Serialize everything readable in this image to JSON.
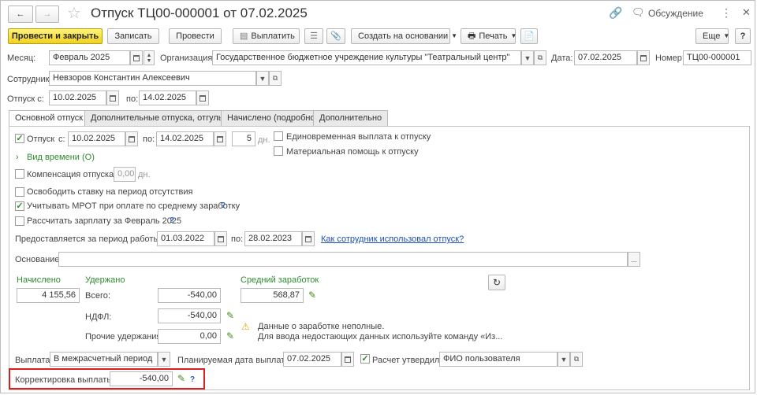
{
  "window": {
    "title": "Отпуск ТЦ00-000001 от 07.02.2025",
    "discussion_label": "Обсуждение"
  },
  "toolbar": {
    "post_close": "Провести и закрыть",
    "save": "Записать",
    "post": "Провести",
    "pay": "Выплатить",
    "create_based_on": "Создать на основании",
    "print": "Печать",
    "more": "Еще",
    "help": "?"
  },
  "header": {
    "month_label": "Месяц:",
    "month_value": "Февраль 2025",
    "org_label": "Организация:",
    "org_value": "Государственное бюджетное учреждение культуры \"Театральный центр\"",
    "date_label": "Дата:",
    "date_value": "07.02.2025",
    "number_label": "Номер:",
    "number_value": "ТЦ00-000001",
    "employee_label": "Сотрудник:",
    "employee_value": "Невзоров Константин Алексеевич",
    "vac_from_label": "Отпуск с:",
    "vac_from_value": "10.02.2025",
    "vac_to_label": "по:",
    "vac_to_value": "14.02.2025"
  },
  "tabs": [
    {
      "label": "Основной отпуск",
      "active": true
    },
    {
      "label": "Дополнительные отпуска, отгулы",
      "active": false
    },
    {
      "label": "Начислено (подробно)",
      "active": false
    },
    {
      "label": "Дополнительно",
      "active": false
    }
  ],
  "main": {
    "vacation_label": "Отпуск",
    "vacation_checked": true,
    "from_label": "с:",
    "from_value": "10.02.2025",
    "to_label": "по:",
    "to_value": "14.02.2025",
    "days_value": "5",
    "days_unit": "дн.",
    "lump_sum_label": "Единовременная выплата к отпуску",
    "material_aid_label": "Материальная помощь к отпуску",
    "time_type_label": "Вид времени (О)",
    "compensation_label": "Компенсация отпуска",
    "compensation_value": "0,00",
    "compensation_unit": "дн.",
    "free_rate_label": "Освободить ставку на период отсутствия",
    "mrot_label": "Учитывать МРОТ при оплате по среднему заработку",
    "mrot_checked": true,
    "calc_salary_label": "Рассчитать зарплату за Февраль 2025",
    "period_label": "Предоставляется за период работы с:",
    "period_from": "01.03.2022",
    "period_to_label": "по:",
    "period_to": "28.02.2023",
    "usage_link": "Как сотрудник использовал отпуск?",
    "basis_label": "Основание:",
    "basis_value": "",
    "accrued_header": "Начислено",
    "accrued_value": "4 155,56",
    "withheld_header": "Удержано",
    "total_label": "Всего:",
    "total_value": "-540,00",
    "ndfl_label": "НДФЛ:",
    "ndfl_value": "-540,00",
    "other_label": "Прочие удержания:",
    "other_value": "0,00",
    "avg_header": "Средний заработок",
    "avg_value": "568,87",
    "warning_line1": "Данные о заработке неполные.",
    "warning_line2": "Для ввода недостающих данных используйте команду «Из...",
    "payout_label": "Выплата:",
    "payout_value": "В межрасчетный период",
    "planned_date_label": "Планируемая дата выплаты:",
    "planned_date_value": "07.02.2025",
    "approved_label": "Расчет утвердил",
    "approved_checked": true,
    "approved_value": "ФИО пользователя",
    "adjust_label": "Корректировка выплаты:",
    "adjust_value": "-540,00",
    "help_mark": "?"
  },
  "colors": {
    "primary_button": "#f0d120",
    "green_text": "#2e8b2e",
    "link": "#1b4fb5",
    "highlight_box": "#d9201f"
  }
}
